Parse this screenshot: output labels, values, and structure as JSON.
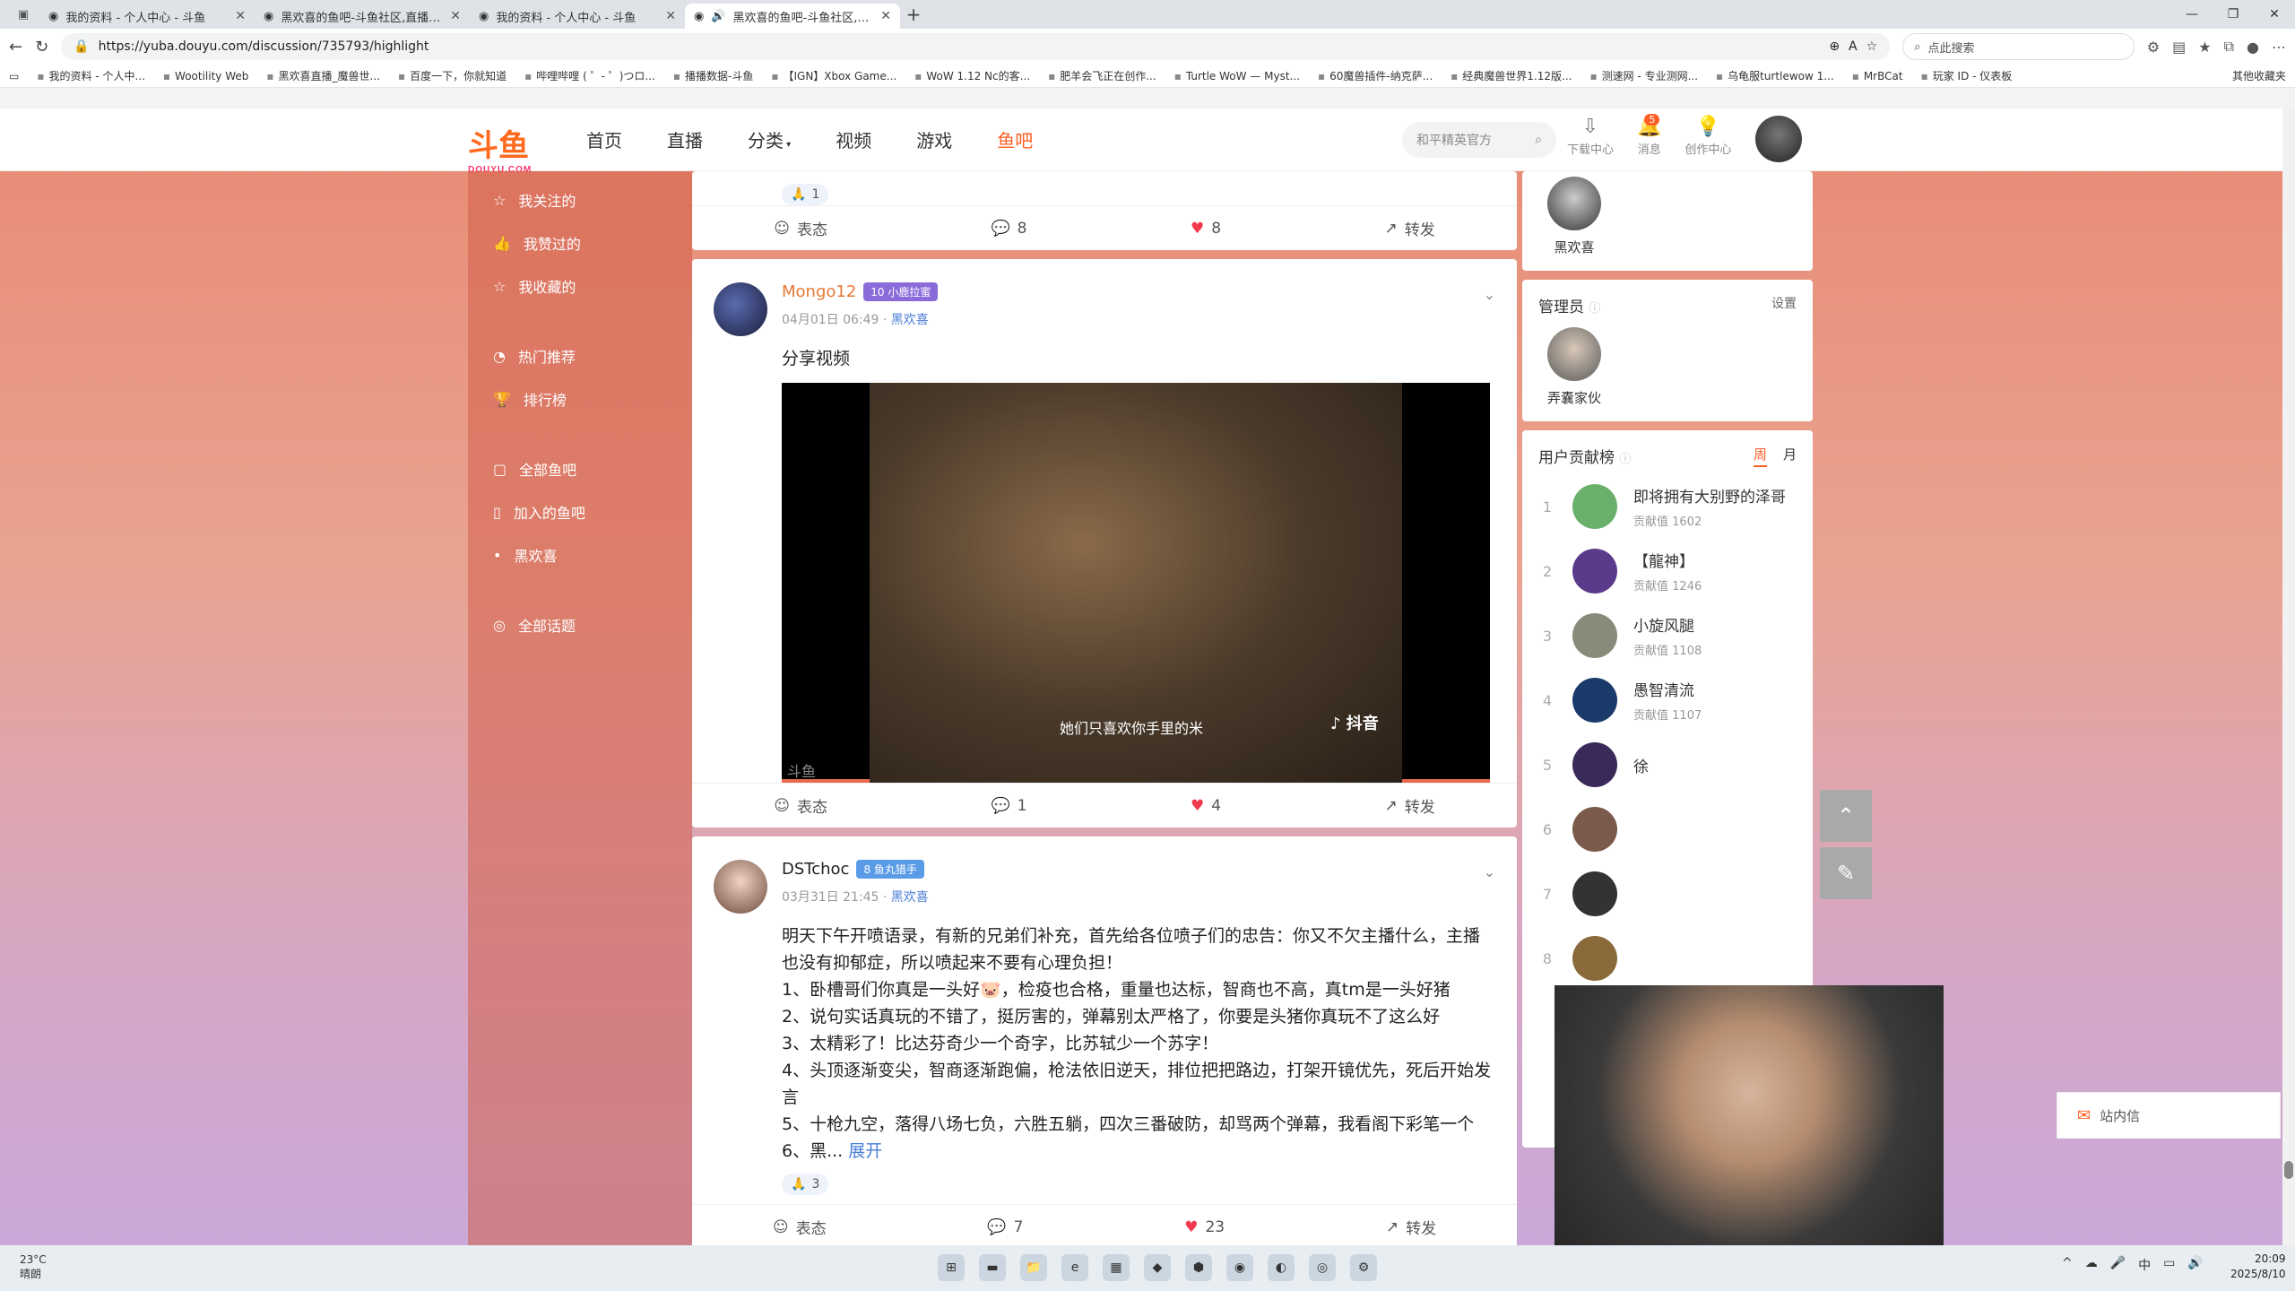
{
  "browser": {
    "tabs": [
      {
        "title": "我的资料 - 个人中心 - 斗鱼",
        "active": false
      },
      {
        "title": "黑欢喜的鱼吧-斗鱼社区,直播爱好",
        "active": false
      },
      {
        "title": "我的资料 - 个人中心 - 斗鱼",
        "active": false
      },
      {
        "title": "黑欢喜的鱼吧-斗鱼社区,直播",
        "active": true
      }
    ],
    "url": "https://yuba.douyu.com/discussion/735793/highlight",
    "search_placeholder": "点此搜索",
    "bookmarks": [
      "我的资料 - 个人中...",
      "Wootility Web",
      "黑欢喜直播_魔兽世...",
      "百度一下，你就知道",
      "哔哩哔哩 ( ゜- ゜)つロ...",
      "播播数据-斗鱼",
      "【IGN】Xbox Game...",
      "WoW 1.12 Nc的客...",
      "肥羊会飞正在创作...",
      "Turtle WoW — Myst...",
      "60魔兽插件-纳克萨...",
      "经典魔兽世界1.12版...",
      "测速网 - 专业测网...",
      "乌龟服turtlewow 1...",
      "MrBCat",
      "玩家 ID - 仪表板"
    ],
    "other_bookmarks": "其他收藏夹"
  },
  "site": {
    "logo": "斗鱼",
    "logo_sub": "DOUYU.COM",
    "nav": [
      "首页",
      "直播",
      "分类",
      "视频",
      "游戏",
      "鱼吧"
    ],
    "search_placeholder": "和平精英官方",
    "download": "下载中心",
    "messages": "消息",
    "messages_badge": "5",
    "creator": "创作中心"
  },
  "sidebar": {
    "group1": [
      "我关注的",
      "我赞过的",
      "我收藏的"
    ],
    "group2": [
      "热门推荐",
      "排行榜"
    ],
    "group3": [
      "全部鱼吧",
      "加入的鱼吧",
      "黑欢喜"
    ],
    "group4": [
      "全部话题"
    ]
  },
  "top_card": {
    "emoji_count": "1",
    "react": "表态",
    "comments": "8",
    "likes": "8",
    "share": "转发"
  },
  "post1": {
    "author": "Mongo12",
    "level": "10",
    "badge": "小鹿拉蜜",
    "date": "04月01日 06:49",
    "bar": "黑欢喜",
    "text": "分享视频",
    "video_caption": "她们只喜欢你手里的米",
    "video_logo": "抖音",
    "watermark": "斗鱼",
    "react": "表态",
    "comments": "1",
    "likes": "4",
    "share": "转发"
  },
  "post2": {
    "author": "DSTchoc",
    "level": "8",
    "badge": "鱼丸猎手",
    "date": "03月31日 21:45",
    "bar": "黑欢喜",
    "lines": [
      "明天下午开喷语录，有新的兄弟们补充，首先给各位喷子们的忠告：你又不欠主播什么，主播也没有抑郁症，所以喷起来不要有心理负担！",
      "1、卧槽哥们你真是一头好🐷，检疫也合格，重量也达标，智商也不高，真tm是一头好猪",
      "2、说句实话真玩的不错了，挺厉害的，弹幕别太严格了，你要是头猪你真玩不了这么好",
      "3、太精彩了！比达芬奇少一个奇字，比苏轼少一个苏字！",
      "4、头顶逐渐变尖，智商逐渐跑偏，枪法依旧逆天，排位把把路边，打架开镜优先，死后开始发言",
      "5、十枪九空，落得八场七负，六胜五躺，四次三番破防，却骂两个弹幕，我看阁下彩笔一个"
    ],
    "last_line": "6、黑...",
    "expand": "展开",
    "emoji_count": "3",
    "react": "表态",
    "comments": "7",
    "likes": "23",
    "share": "转发"
  },
  "right": {
    "owner_name": "黑欢喜",
    "admin_title": "管理员",
    "admin_settings": "设置",
    "admin_name": "弄囊家伙",
    "rank_title": "用户贡献榜",
    "rank_tabs": [
      "周",
      "月"
    ],
    "rank_value_label": "贡献值",
    "ranks": [
      {
        "n": "1",
        "name": "即将拥有大别野的泽哥",
        "value": "1602"
      },
      {
        "n": "2",
        "name": "【龍神】",
        "value": "1246"
      },
      {
        "n": "3",
        "name": "小旋风腿",
        "value": "1108"
      },
      {
        "n": "4",
        "name": "愚智清流",
        "value": "1107"
      },
      {
        "n": "5",
        "name": "徐",
        "value": ""
      },
      {
        "n": "6",
        "name": "",
        "value": ""
      },
      {
        "n": "7",
        "name": "",
        "value": ""
      },
      {
        "n": "8",
        "name": "",
        "value": ""
      }
    ]
  },
  "inbox": "站内信",
  "taskbar": {
    "temp": "23°C",
    "weather": "晴朗",
    "time": "20:09",
    "date": "2025/8/10",
    "ime": "中"
  }
}
